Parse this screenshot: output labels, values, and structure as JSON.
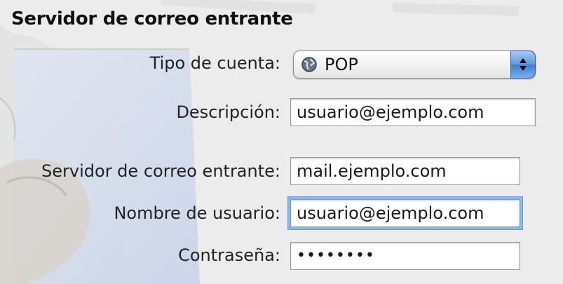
{
  "section": {
    "title": "Servidor de correo entrante"
  },
  "account_type": {
    "label": "Tipo de cuenta:",
    "value": "POP",
    "icon": "globe-icon"
  },
  "description": {
    "label": "Descripción:",
    "value": "usuario@ejemplo.com"
  },
  "incoming_server": {
    "label": "Servidor de correo entrante:",
    "value": "mail.ejemplo.com"
  },
  "username": {
    "label": "Nombre de usuario:",
    "value": "usuario@ejemplo.com"
  },
  "password": {
    "label": "Contraseña:",
    "value": "••••••••"
  },
  "colors": {
    "focus_ring": "#8db6ea",
    "popup_stepper": "#4f8ad6",
    "background": "#ececec"
  }
}
